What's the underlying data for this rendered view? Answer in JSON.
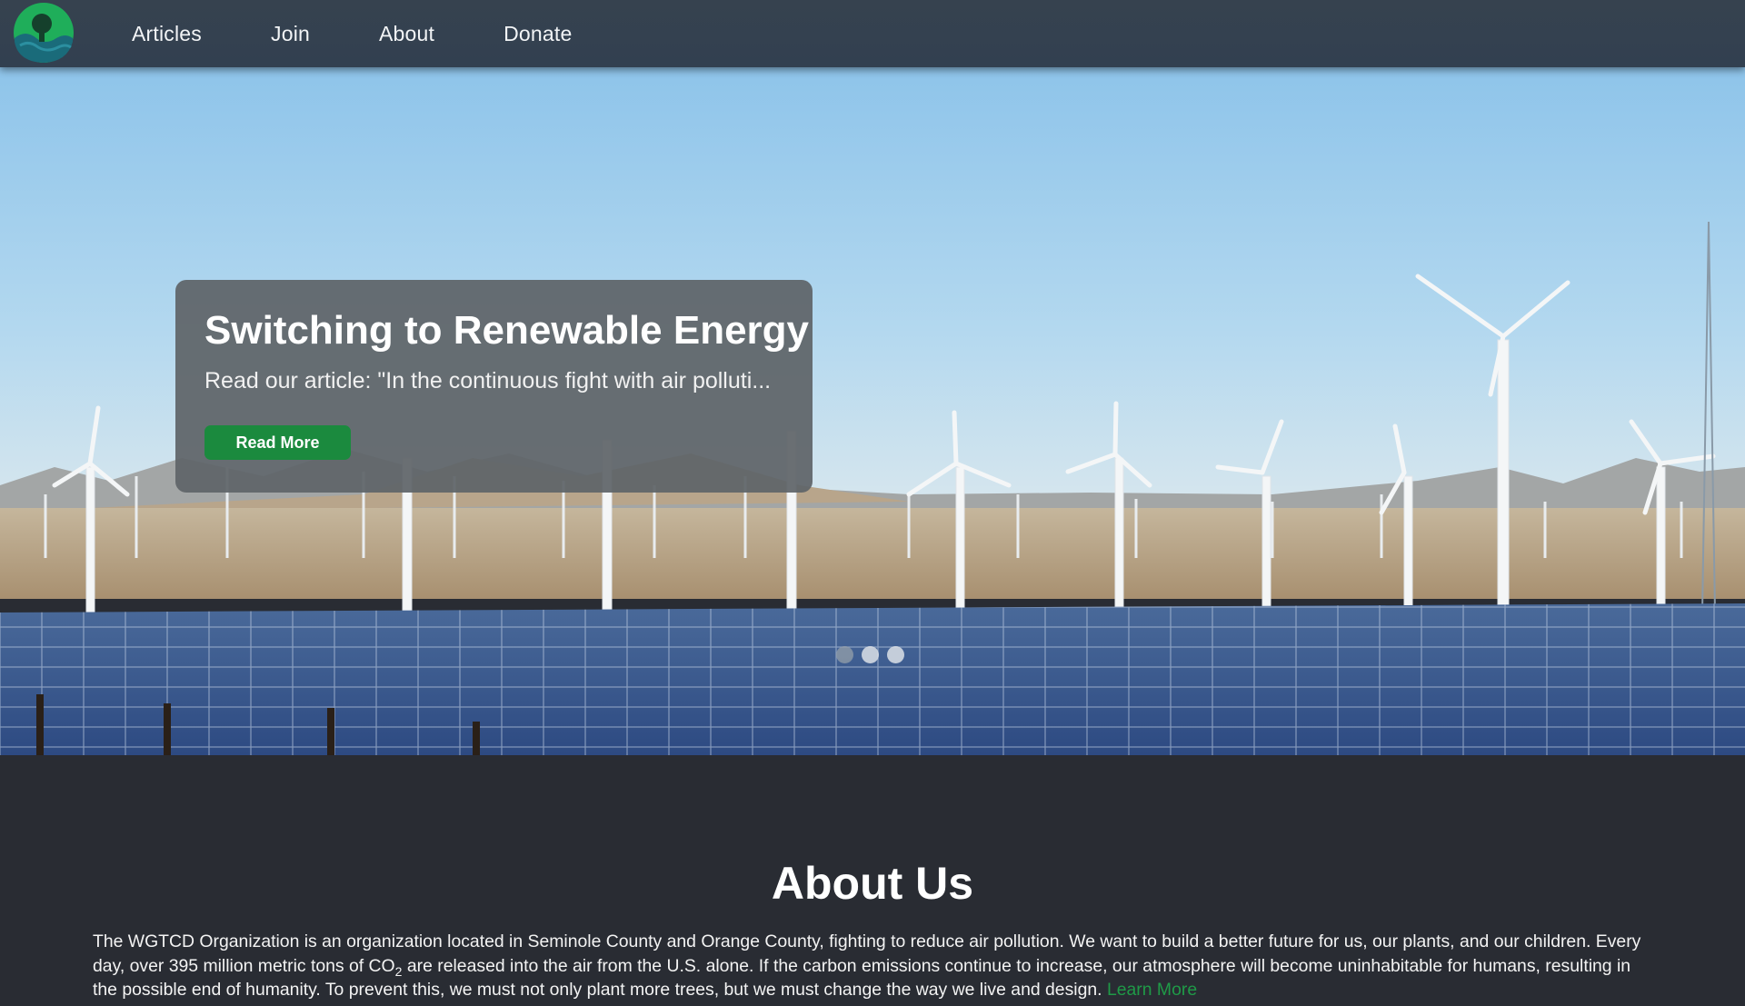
{
  "nav": {
    "logo": "tree-globe-logo",
    "links": [
      "Articles",
      "Join",
      "About",
      "Donate"
    ]
  },
  "hero": {
    "title": "Switching to Renewable Energy",
    "text": "Read our article: \"In the continuous fight with air polluti...",
    "button_label": "Read More",
    "slides_total": 3,
    "active_slide": 1
  },
  "about": {
    "title": "About Us",
    "text_part1": "The WGTCD Organization is an organization located in Seminole County and Orange County, fighting to reduce air pollution. We want to build a better future for us, our plants, and our children. Every day, over 395 million metric tons of CO",
    "text_sub": "2",
    "text_part2": " are released into the air from the U.S. alone. If the carbon emissions continue to increase, our atmosphere will become uninhabitable for humans, resulting in the possible end of humanity. To prevent this, we must not only plant more trees, but we must change the way we live and design. ",
    "link_label": "Learn More"
  },
  "colors": {
    "navbar": "#34414f",
    "accent_green": "#1b8a3e",
    "link_green": "#1f9a47",
    "page_bg": "#292c33"
  }
}
